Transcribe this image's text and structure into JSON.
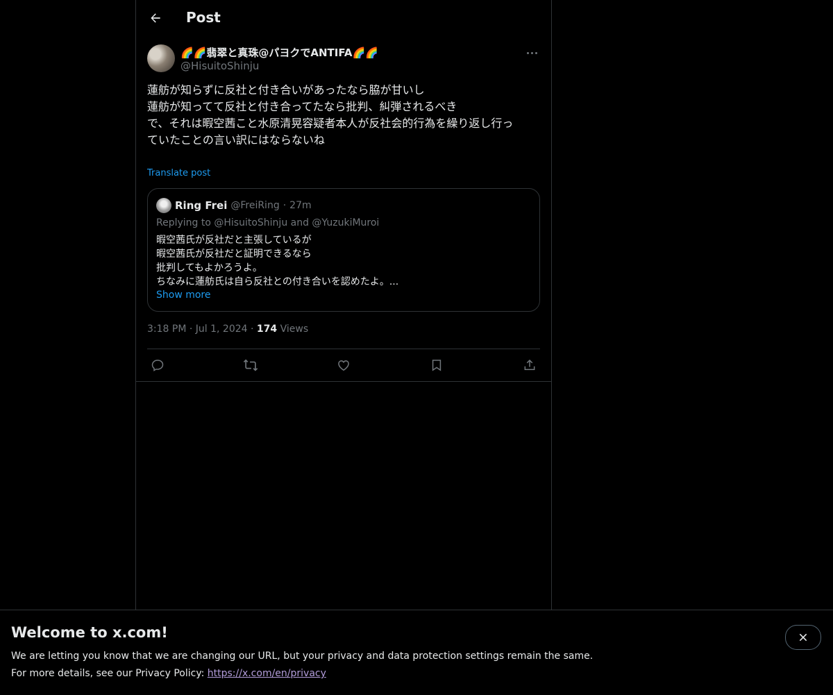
{
  "header": {
    "title": "Post"
  },
  "post": {
    "author_name": "🌈🌈翡翠と真珠@パヨクでANTIFA🌈🌈",
    "author_handle": "@HisuitoShinju",
    "lines": [
      "蓮舫が知らずに反社と付き合いがあったなら脇が甘いし",
      "蓮舫が知ってて反社と付き合ってたなら批判、糾弾されるべき",
      "",
      "で、それは暇空茜こと水原清晃容疑者本人が反社会的行為を繰り返し行っ",
      "ていたことの言い訳にはならないね"
    ],
    "translate_label": "Translate post",
    "time": "3:18 PM",
    "date": "Jul 1, 2024",
    "views_count": "174",
    "views_label": "Views"
  },
  "quote": {
    "name": "Ring Frei",
    "handle": "@FreiRing",
    "age": "27m",
    "reply_to": "Replying to @HisuitoShinju and @YuzukiMuroi",
    "lines": [
      "暇空茜氏が反社だと主張しているが",
      "暇空茜氏が反社だと証明できるなら",
      "批判してもよかろうよ。",
      "ちなみに蓮舫氏は自ら反社との付き合いを認めたよ。..."
    ],
    "show_more": "Show more"
  },
  "actions": [
    "reply-icon",
    "repost-icon",
    "like-icon",
    "bookmark-icon",
    "share-icon"
  ],
  "banner": {
    "title": "Welcome to x.com!",
    "line1": "We are letting you know that we are changing our URL, but your privacy and data protection settings remain the same.",
    "line2_prefix": "For more details, see our Privacy Policy: ",
    "link": "https://x.com/en/privacy"
  },
  "colors": {
    "accent": "#1d9bf0",
    "background": "#000000",
    "border": "#2f3336",
    "muted": "#71767b"
  }
}
